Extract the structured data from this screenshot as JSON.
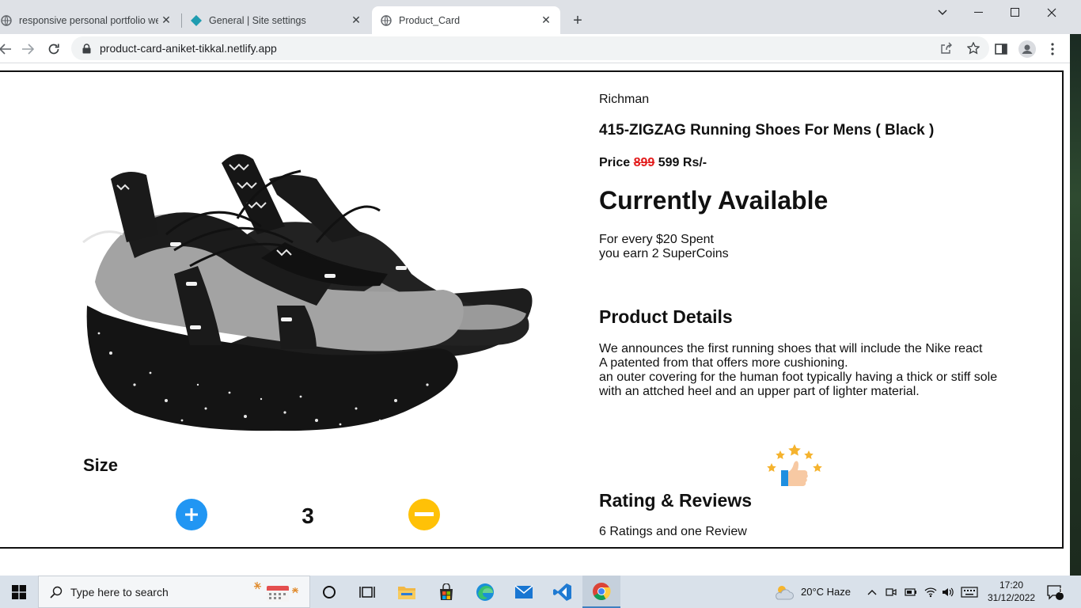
{
  "browser": {
    "tabs": [
      {
        "title": "responsive personal portfolio we"
      },
      {
        "title": "General | Site settings"
      },
      {
        "title": "Product_Card"
      }
    ],
    "url": "product-card-aniket-tikkal.netlify.app"
  },
  "product": {
    "brand": "Richman",
    "name": "415-ZIGZAG Running Shoes For Mens ( Black )",
    "price_label": "Price",
    "old_price": "899",
    "new_price": "599 Rs/-",
    "availability": "Currently Available",
    "coins_line1": "For every $20 Spent",
    "coins_line2": "you earn 2 SuperCoins",
    "details_title": "Product Details",
    "details_lines": [
      "We announces the first running shoes that will include the Nike react",
      "A patented from that offers more cushioning.",
      "an outer covering for the human foot typically having a thick or stiff sole",
      "with an attched heel and an upper part of lighter material."
    ],
    "size_title": "Size",
    "quantity": "3",
    "rating_title": "Rating & Reviews",
    "rating_text": "6 Ratings and one Review"
  },
  "taskbar": {
    "search_placeholder": "Type here to search",
    "weather": "20°C  Haze",
    "time": "17:20",
    "date": "31/12/2022",
    "notification_count": "1"
  },
  "colors": {
    "plus_button": "#2196f3",
    "minus_button": "#ffc107",
    "old_price": "#e21b1b"
  }
}
